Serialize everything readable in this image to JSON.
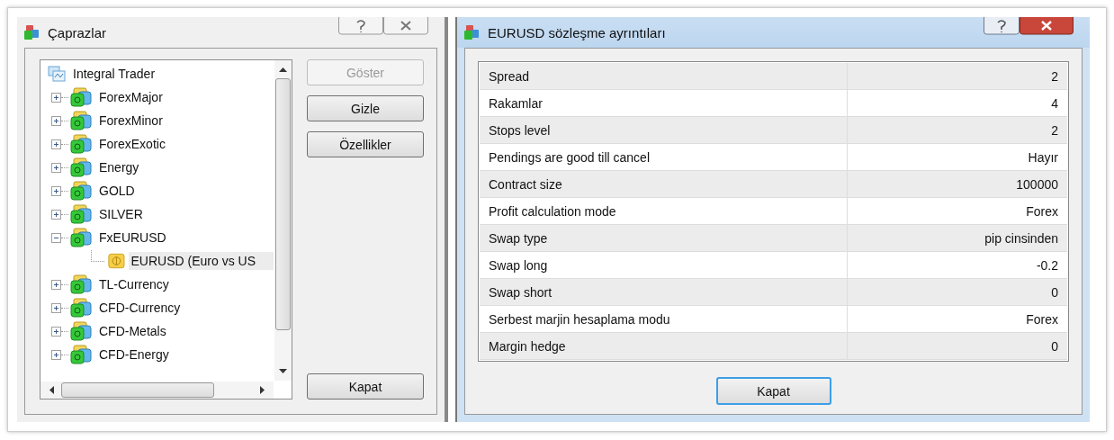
{
  "left_window": {
    "title": "Çaprazlar",
    "tree": {
      "label": "Integral Trader",
      "children": [
        {
          "label": "ForexMajor",
          "expanded": false,
          "selected": false
        },
        {
          "label": "ForexMinor",
          "expanded": false,
          "selected": false
        },
        {
          "label": "ForexExotic",
          "expanded": false,
          "selected": false
        },
        {
          "label": "Energy",
          "expanded": false,
          "selected": false
        },
        {
          "label": "GOLD",
          "expanded": false,
          "selected": false
        },
        {
          "label": "SILVER",
          "expanded": false,
          "selected": false
        },
        {
          "label": "FxEURUSD",
          "expanded": true,
          "selected": false,
          "children": [
            {
              "label": "EURUSD  (Euro vs US",
              "selected": true
            }
          ]
        },
        {
          "label": "TL-Currency",
          "expanded": false,
          "selected": false
        },
        {
          "label": "CFD-Currency",
          "expanded": false,
          "selected": false
        },
        {
          "label": "CFD-Metals",
          "expanded": false,
          "selected": false
        },
        {
          "label": "CFD-Energy",
          "expanded": false,
          "selected": false
        }
      ]
    },
    "buttons": [
      {
        "label": "Göster",
        "disabled": true
      },
      {
        "label": "Gizle",
        "disabled": false
      },
      {
        "label": "Özellikler",
        "disabled": false
      }
    ],
    "close_button": {
      "label": "Kapat"
    }
  },
  "right_window": {
    "title": "EURUSD sözleşme ayrıntıları",
    "rows": [
      {
        "name": "Spread",
        "value": "2"
      },
      {
        "name": "Rakamlar",
        "value": "4"
      },
      {
        "name": "Stops level",
        "value": "2"
      },
      {
        "name": "Pendings are good till cancel",
        "value": "Hayır"
      },
      {
        "name": "Contract size",
        "value": "100000"
      },
      {
        "name": "Profit calculation mode",
        "value": "Forex"
      },
      {
        "name": "Swap type",
        "value": "pip cinsinden"
      },
      {
        "name": "Swap long",
        "value": "-0.2"
      },
      {
        "name": "Swap short",
        "value": "0"
      },
      {
        "name": "Serbest marjin hesaplama modu",
        "value": "Forex"
      },
      {
        "name": "Margin hedge",
        "value": "0"
      }
    ],
    "close_button": {
      "label": "Kapat",
      "focused": true
    }
  }
}
